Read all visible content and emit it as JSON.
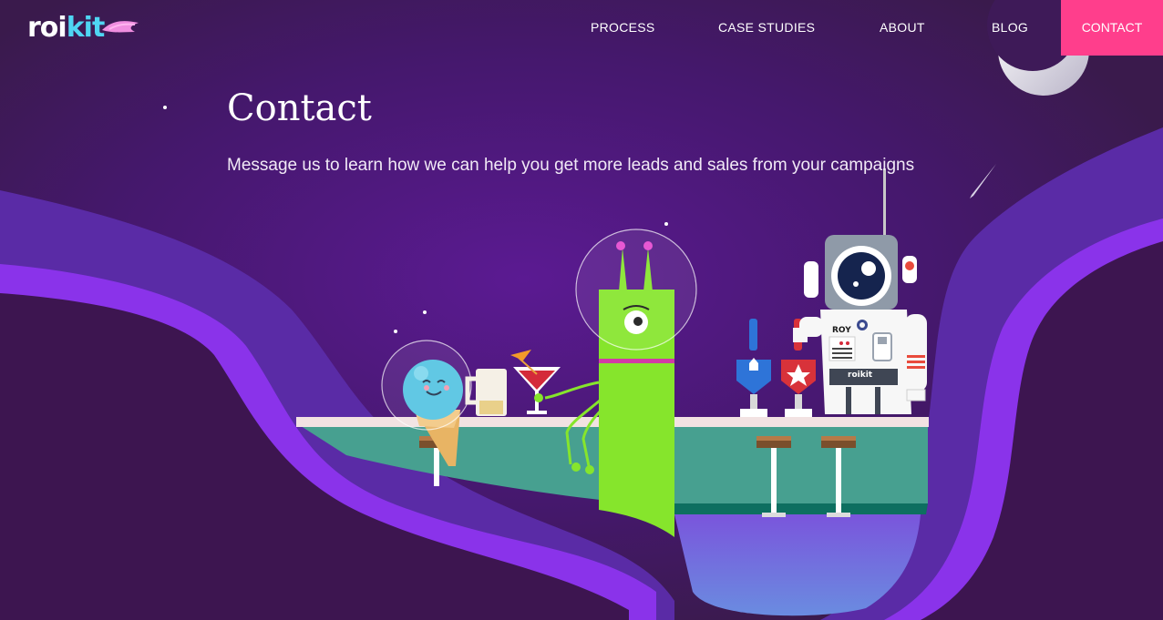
{
  "brand": {
    "logo_text_a": "roi",
    "logo_text_b": "kit"
  },
  "nav": {
    "items": [
      {
        "label": "PROCESS"
      },
      {
        "label": "CASE STUDIES"
      },
      {
        "label": "ABOUT"
      },
      {
        "label": "BLOG"
      }
    ],
    "contact_label": "CONTACT"
  },
  "hero": {
    "title": "Contact",
    "subtitle": "Message us to learn how we can help you get more leads and sales from your campaigns"
  },
  "illustration": {
    "astronaut_badge": "ROY",
    "astronaut_belt_logo": "roikit"
  },
  "colors": {
    "accent_pink": "#ff3e8c",
    "logo_cyan": "#4fd6f3",
    "background_top": "#3a1b4f",
    "background_mid": "#55168a",
    "bar_counter": "#47a090",
    "alien_green": "#86e52c"
  }
}
